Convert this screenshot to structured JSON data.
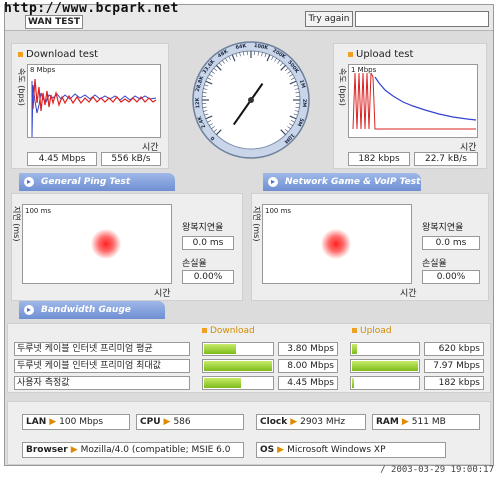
{
  "header": {
    "watermark": "http://www.bcpark.net",
    "tab": "WAN TEST",
    "try_again": "Try again",
    "try_input": ""
  },
  "download": {
    "title": "Download test",
    "ylabel": "속도 (bps)",
    "scale": "8 Mbps",
    "xlabel": "시간",
    "value_bps": "4.45 Mbps",
    "value_Bps": "556 kB/s"
  },
  "upload": {
    "title": "Upload test",
    "ylabel": "속도 (bps)",
    "scale": "1 Mbps",
    "xlabel": "시간",
    "value_bps": "182 kbps",
    "value_Bps": "22.7 kB/s"
  },
  "gauge": {
    "ticks": [
      "10M",
      "5M",
      "2M",
      "1M",
      "500K",
      "200K",
      "100K",
      "64K",
      "48K",
      "33.6K",
      "28.8K",
      "12K",
      "2.4K",
      "0"
    ],
    "value": "4.45 Mbps"
  },
  "ping": {
    "general_tab": "General Ping Test",
    "game_tab": "Network Game & VoIP Test",
    "bandwidth_tab": "Bandwidth Gauge",
    "left": {
      "ylabel": "지연 (ms)",
      "scale": "100 ms",
      "xlabel": "시간",
      "rtt_label": "왕복지연율",
      "rtt_value": "0.0 ms",
      "loss_label": "손실율",
      "loss_value": "0.00%"
    },
    "right": {
      "ylabel": "지연 (ms)",
      "scale": "100 ms",
      "xlabel": "시간",
      "rtt_label": "왕복지연율",
      "rtt_value": "0.0 ms",
      "loss_label": "손실율",
      "loss_value": "0.00%"
    }
  },
  "bandwidth": {
    "download_head": "Download",
    "upload_head": "Upload",
    "rows": [
      {
        "label": "두루넷 케이블 인터넷 프리미엄 평균",
        "down": "3.80 Mbps",
        "down_ratio": 0.47,
        "up": "620 kbps",
        "up_ratio": 0.08
      },
      {
        "label": "두루넷 케이블 인터넷 프리미엄 최대값",
        "down": "8.00 Mbps",
        "down_ratio": 1.0,
        "up": "7.97 Mbps",
        "up_ratio": 1.0
      },
      {
        "label": "사용자 측정값",
        "down": "4.45 Mbps",
        "down_ratio": 0.55,
        "up": "182 kbps",
        "up_ratio": 0.02
      }
    ]
  },
  "specs": {
    "lan_label": "LAN",
    "lan": "100 Mbps",
    "cpu_label": "CPU",
    "cpu": "586",
    "clock_label": "Clock",
    "clock": "2903 MHz",
    "ram_label": "RAM",
    "ram": "511 MB",
    "browser_label": "Browser",
    "browser": "Mozilla/4.0 (compatible; MSIE 6.0",
    "os_label": "OS",
    "os": "Microsoft Windows XP"
  },
  "footer": {
    "timestamp": "/ 2003-03-29 19:00:17"
  }
}
